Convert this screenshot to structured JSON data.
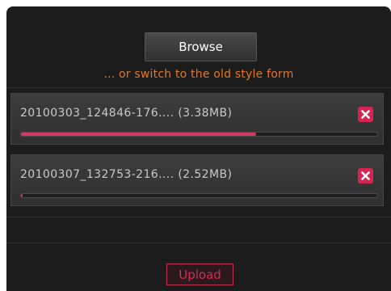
{
  "browse": {
    "label": "Browse"
  },
  "switch_link": {
    "text": "... or switch to the old style form"
  },
  "files": [
    {
      "name": "20100303_124846-176.... (3.38MB)",
      "progress": 0.66
    },
    {
      "name": "20100307_132753-216.... (2.52MB)",
      "progress": 0.005
    }
  ],
  "upload": {
    "label": "Upload"
  },
  "colors": {
    "panel_background": "#1c1c1c",
    "link_orange": "#e8761c",
    "accent_pink": "#d62453",
    "progress_fill": "#d43b64"
  },
  "icons": {
    "remove": "close-icon"
  }
}
